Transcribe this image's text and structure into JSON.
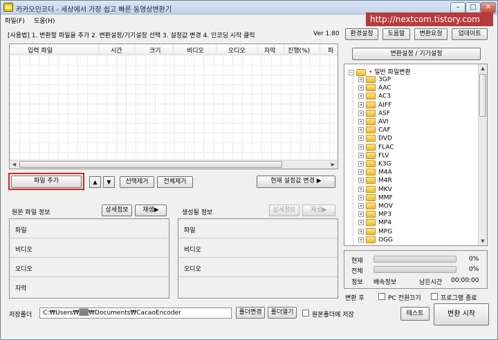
{
  "window": {
    "title": "카카오인코더 - 세상에서 가장 쉽고 빠른 동영상변환기",
    "watermark": "http://nextcom.tistory.com"
  },
  "menu": [
    "파일(F)",
    "도움(H)"
  ],
  "guide": {
    "text": "[사용법] 1. 변환할 파일을 추가  2. 변환설정/기기설정 선택  3. 설정값 변경  4. 인코딩 시작 클릭",
    "version": "Ver 1.80"
  },
  "top_buttons": [
    "환경설정",
    "도움말",
    "변환요청",
    "업데이트"
  ],
  "file_table": {
    "columns": [
      "입력 파일",
      "시간",
      "크기",
      "비디오",
      "오디오",
      "자막",
      "진행(%)",
      "파"
    ],
    "rows": []
  },
  "list_buttons": {
    "add": "파일 추가",
    "up": "▲",
    "down": "▼",
    "remove_selected": "선택제거",
    "remove_all": "전체제거",
    "change_settings": "현재 설정값 변경 ▶"
  },
  "source_info": {
    "title": "원본 파일 정보",
    "detail_button": "상세정보",
    "play_button": "재생▶",
    "rows": [
      "파일",
      "비디오",
      "오디오",
      "자막"
    ]
  },
  "output_info": {
    "title": "생성될 정보",
    "detail_button": "상세정보",
    "play_button": "재생▶",
    "rows": [
      "파일",
      "비디오",
      "오디오"
    ]
  },
  "settings_panel": {
    "header": "변환설정 / 기기설정",
    "root": "일반 파일변환",
    "formats": [
      "3GP",
      "AAC",
      "AC3",
      "AIFF",
      "ASF",
      "AVI",
      "CAF",
      "DVD",
      "FLAC",
      "FLV",
      "K3G",
      "M4A",
      "M4R",
      "MKV",
      "MMF",
      "MOV",
      "MP3",
      "MP4",
      "MPG",
      "OGG"
    ]
  },
  "progress": {
    "current_label": "현재",
    "current_value": 0,
    "current_text": "0%",
    "total_label": "전체",
    "total_value": 0,
    "total_text": "0%",
    "info_label": "정보",
    "speed_label": "배속정보",
    "remaining_label": "남은시간",
    "remaining_time": "00:00:00"
  },
  "after_convert": {
    "label": "변환 후",
    "pc_off": "PC 전원끄기",
    "program_exit": "프로그램 종료"
  },
  "save_folder": {
    "label": "저장폴더",
    "path": "C:₩Users₩▒▒₩Documents₩CacaoEncoder",
    "change_button": "폴더변경",
    "open_button": "폴더열기",
    "same_as_source": "원본폴더에 저장"
  },
  "bottom_buttons": {
    "test": "테스트",
    "start": "변환 시작"
  }
}
